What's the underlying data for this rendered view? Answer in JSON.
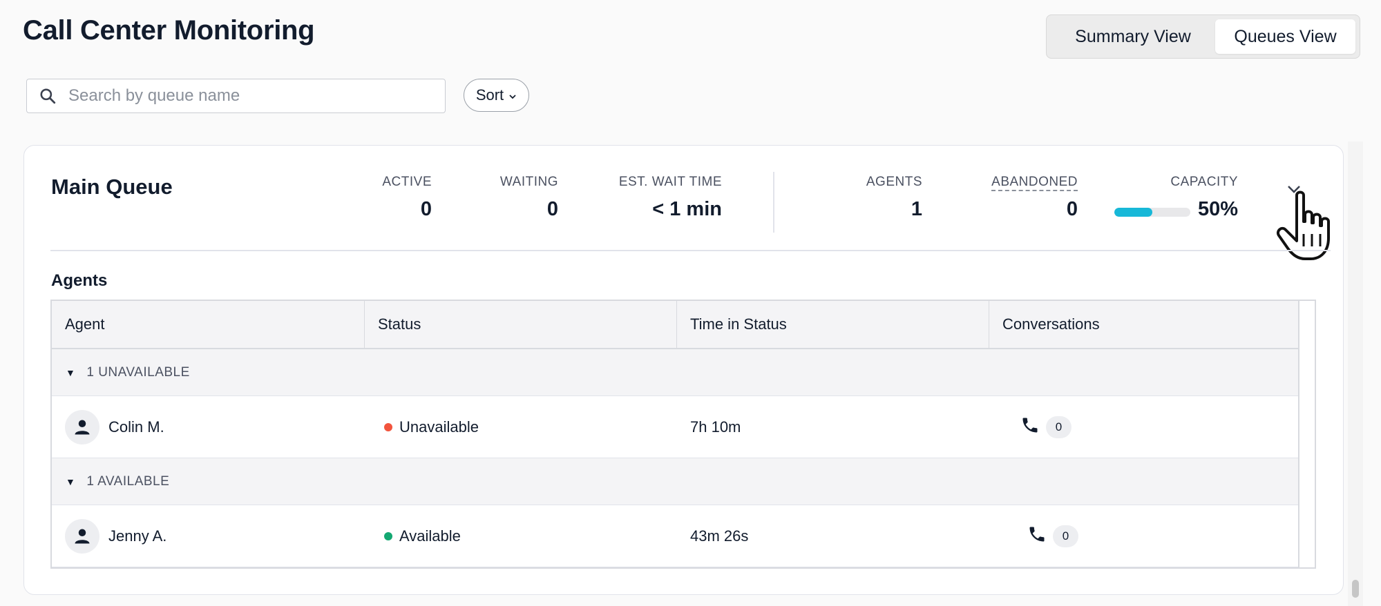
{
  "header": {
    "title": "Call Center Monitoring",
    "views": [
      {
        "label": "Summary View",
        "active": false
      },
      {
        "label": "Queues View",
        "active": true
      }
    ]
  },
  "toolbar": {
    "search_placeholder": "Search by queue name",
    "search_value": "",
    "sort_label": "Sort"
  },
  "queue": {
    "name": "Main Queue",
    "metrics": {
      "active": {
        "label": "ACTIVE",
        "value": "0"
      },
      "waiting": {
        "label": "WAITING",
        "value": "0"
      },
      "est_wait": {
        "label": "EST. WAIT TIME",
        "value": "< 1 min"
      },
      "agents": {
        "label": "AGENTS",
        "value": "1"
      },
      "abandoned": {
        "label": "ABANDONED",
        "value": "0"
      },
      "capacity": {
        "label": "CAPACITY",
        "value": "50%",
        "fraction": 0.5
      }
    },
    "capacity_color": "#17b8d8",
    "agents_heading": "Agents",
    "table": {
      "columns": [
        "Agent",
        "Status",
        "Time in Status",
        "Conversations"
      ],
      "groups": [
        {
          "label": "1 UNAVAILABLE",
          "agents": [
            {
              "name": "Colin M.",
              "status": "Unavailable",
              "status_color": "#f2543d",
              "time": "7h 10m",
              "conversations": "0"
            }
          ]
        },
        {
          "label": "1 AVAILABLE",
          "agents": [
            {
              "name": "Jenny A.",
              "status": "Available",
              "status_color": "#14a872",
              "time": "43m 26s",
              "conversations": "0"
            }
          ]
        }
      ]
    }
  },
  "icons": {
    "search": "search-icon",
    "sort_chevron": "chevron-down-icon",
    "expand": "chevron-down-icon",
    "avatar": "user-icon",
    "phone": "phone-icon",
    "cursor": "hand-pointer-icon",
    "group_caret": "caret-down-icon"
  }
}
